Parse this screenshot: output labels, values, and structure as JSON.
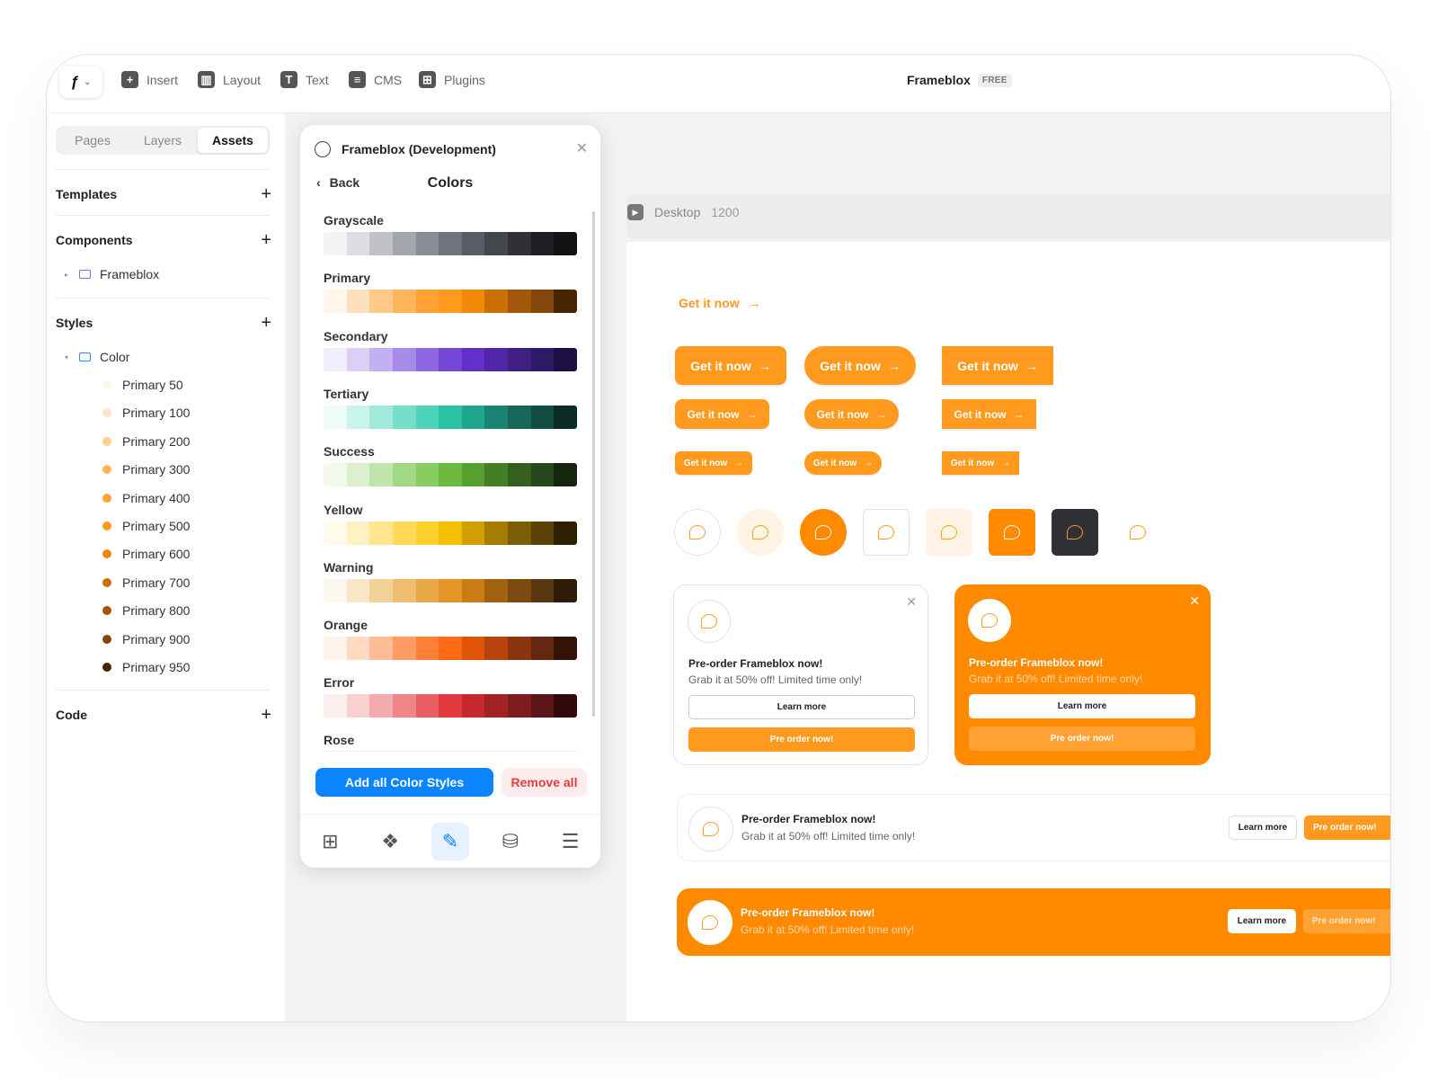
{
  "toolbar": {
    "insert": "Insert",
    "layout": "Layout",
    "text": "Text",
    "cms": "CMS",
    "plugins": "Plugins",
    "project_name": "Frameblox",
    "plan_badge": "FREE"
  },
  "sidebar": {
    "tabs": [
      "Pages",
      "Layers",
      "Assets"
    ],
    "active_tab": "Assets",
    "templates": "Templates",
    "components": "Components",
    "components_folder": "Frameblox",
    "styles": "Styles",
    "styles_folder": "Color",
    "color_styles": [
      {
        "name": "Primary 50",
        "color": "#fff6ea"
      },
      {
        "name": "Primary 100",
        "color": "#ffe6c6"
      },
      {
        "name": "Primary 200",
        "color": "#ffcf8f"
      },
      {
        "name": "Primary 300",
        "color": "#ffb65c"
      },
      {
        "name": "Primary 400",
        "color": "#ffa233"
      },
      {
        "name": "Primary 500",
        "color": "#ff9a1f"
      },
      {
        "name": "Primary 600",
        "color": "#f08a06"
      },
      {
        "name": "Primary 700",
        "color": "#cc6f02"
      },
      {
        "name": "Primary 800",
        "color": "#a35708"
      },
      {
        "name": "Primary 900",
        "color": "#83470b"
      },
      {
        "name": "Primary 950",
        "color": "#4b2503"
      }
    ],
    "code": "Code"
  },
  "plugin": {
    "title": "Frameblox (Development)",
    "back": "Back",
    "heading": "Colors",
    "ramps": [
      {
        "name": "Grayscale",
        "colors": [
          "#f3f4f6",
          "#dcdde0",
          "#c0c2c7",
          "#a3a6ad",
          "#8a8d95",
          "#70737c",
          "#595c64",
          "#44464d",
          "#2f3136",
          "#1d1e21",
          "#111214"
        ]
      },
      {
        "name": "Primary",
        "colors": [
          "#fff6ea",
          "#ffe0bc",
          "#ffc989",
          "#ffb65c",
          "#ffa233",
          "#ff9a1f",
          "#f08a06",
          "#cc6f02",
          "#a35708",
          "#83470b",
          "#4b2503"
        ]
      },
      {
        "name": "Secondary",
        "colors": [
          "#f1eefc",
          "#dccff6",
          "#c4b0f0",
          "#a68be8",
          "#8a66df",
          "#7446d6",
          "#6230c9",
          "#5026a6",
          "#3f1f82",
          "#301965",
          "#1f1043"
        ]
      },
      {
        "name": "Tertiary",
        "colors": [
          "#eefcf8",
          "#c9f4ea",
          "#a1eadb",
          "#76dfca",
          "#4dd3b8",
          "#2bc3a5",
          "#1fa58c",
          "#1a8473",
          "#16665a",
          "#124b43",
          "#0b2b27"
        ]
      },
      {
        "name": "Success",
        "colors": [
          "#f1f9ec",
          "#dbf0cf",
          "#c0e5ab",
          "#a2d883",
          "#86cc5e",
          "#6cbb3e",
          "#56a02d",
          "#437f24",
          "#345f1f",
          "#27451a",
          "#15260e"
        ]
      },
      {
        "name": "Yellow",
        "colors": [
          "#fffbea",
          "#fff1c2",
          "#ffe68e",
          "#ffda57",
          "#ffcf2b",
          "#f5c000",
          "#d19f00",
          "#a57c00",
          "#7d5d04",
          "#5a4207",
          "#2e2103"
        ]
      },
      {
        "name": "Warning",
        "colors": [
          "#fdf8ef",
          "#f8e6c6",
          "#f3d29a",
          "#efbd6f",
          "#e9a847",
          "#e39525",
          "#c87c13",
          "#a2620f",
          "#7c4b10",
          "#5a3710",
          "#2e1c08"
        ]
      },
      {
        "name": "Orange",
        "colors": [
          "#fff2ea",
          "#ffd9c2",
          "#ffbd96",
          "#ff9c63",
          "#ff7f36",
          "#ff6a14",
          "#e0540a",
          "#b6430b",
          "#8b3510",
          "#642811",
          "#331307"
        ]
      },
      {
        "name": "Error",
        "colors": [
          "#fdeeee",
          "#f9cfd0",
          "#f4abad",
          "#ee8587",
          "#e85e61",
          "#e23b3f",
          "#c72a2e",
          "#a22226",
          "#7f1c20",
          "#5d161a",
          "#31090b"
        ]
      }
    ],
    "last_ramp": "Rose",
    "add_all": "Add all Color Styles",
    "remove_all": "Remove all"
  },
  "frame": {
    "name": "Desktop",
    "width_label": "1200"
  },
  "cta": {
    "label": "Get it now",
    "arrow": "→"
  },
  "card": {
    "title": "Pre-order Frameblox now!",
    "subtitle": "Grab it at 50% off! Limited time only!",
    "learn_more": "Learn more",
    "pre_order": "Pre order now!"
  },
  "colors": {
    "accent": "#ff9a1f",
    "banner_orange": "#ff8a00",
    "blue": "#0d84ff",
    "danger": "#e53b3b",
    "dark_tile": "#2f3136"
  }
}
